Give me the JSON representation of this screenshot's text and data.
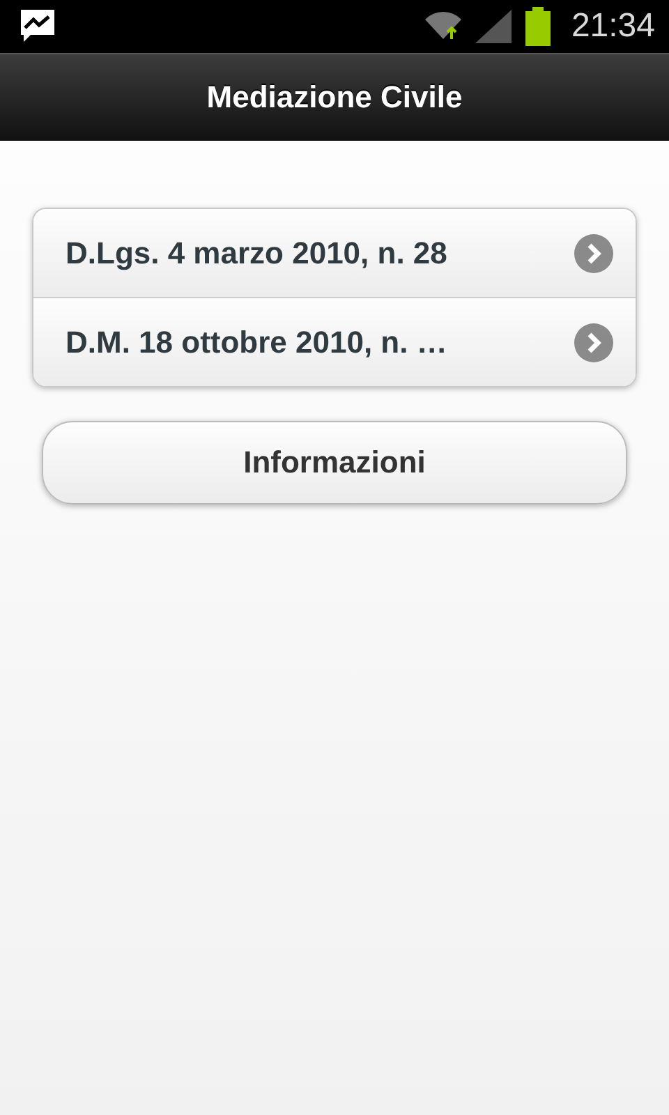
{
  "status_bar": {
    "time": "21:34"
  },
  "header": {
    "title": "Mediazione Civile"
  },
  "list": [
    {
      "label": "D.Lgs. 4 marzo 2010, n. 28"
    },
    {
      "label": "D.M. 18 ottobre 2010, n. …"
    }
  ],
  "button": {
    "label": "Informazioni"
  }
}
